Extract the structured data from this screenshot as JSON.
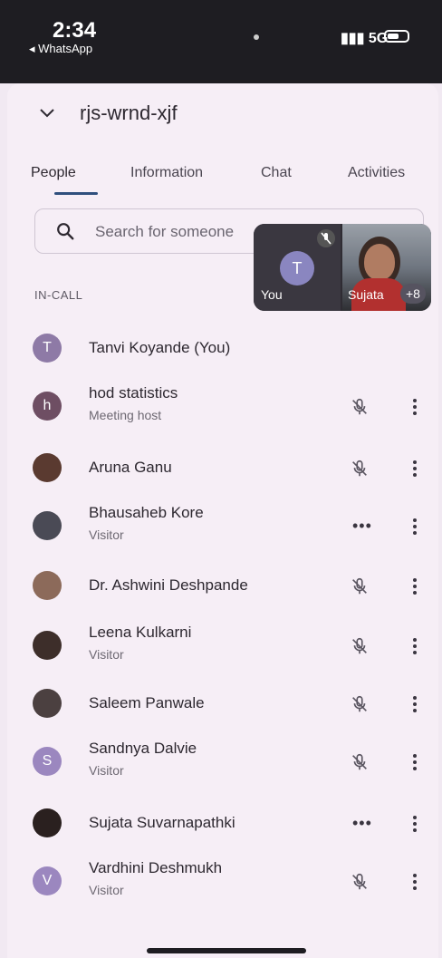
{
  "status_bar": {
    "time": "2:34",
    "back_app": "◂ WhatsApp",
    "network": "5G"
  },
  "header": {
    "title": "rjs-wrnd-xjf"
  },
  "tabs": [
    "People",
    "Information",
    "Chat",
    "Activities"
  ],
  "active_tab": "People",
  "search": {
    "placeholder": "Search for someone"
  },
  "pip": {
    "self_label": "You",
    "self_initial": "T",
    "other_label": "Sujata",
    "more_count": "+8"
  },
  "section_label": "IN-CALL",
  "participants": [
    {
      "name": "Tanvi Koyande (You)",
      "subtitle": "",
      "initial": "T",
      "avatar_color": "#8e7aa6",
      "status": "none"
    },
    {
      "name": "hod statistics",
      "subtitle": "Meeting host",
      "initial": "h",
      "avatar_color": "#6e4e63",
      "status": "muted"
    },
    {
      "name": "Aruna Ganu",
      "subtitle": "",
      "initial": "",
      "avatar_color": "#5a3a30",
      "status": "muted"
    },
    {
      "name": "Bhausaheb Kore",
      "subtitle": "Visitor",
      "initial": "",
      "avatar_color": "#4a4a55",
      "status": "more"
    },
    {
      "name": "Dr. Ashwini Deshpande",
      "subtitle": "",
      "initial": "",
      "avatar_color": "#8c6a5a",
      "status": "muted"
    },
    {
      "name": "Leena Kulkarni",
      "subtitle": "Visitor",
      "initial": "",
      "avatar_color": "#3d2e2a",
      "status": "muted"
    },
    {
      "name": "Saleem Panwale",
      "subtitle": "",
      "initial": "",
      "avatar_color": "#4b4040",
      "status": "muted"
    },
    {
      "name": "Sandnya Dalvie",
      "subtitle": "Visitor",
      "initial": "S",
      "avatar_color": "#9b87bf",
      "status": "muted"
    },
    {
      "name": "Sujata Suvarnapathki",
      "subtitle": "",
      "initial": "",
      "avatar_color": "#2a201f",
      "status": "more"
    },
    {
      "name": "Vardhini Deshmukh",
      "subtitle": "Visitor",
      "initial": "V",
      "avatar_color": "#9b87bf",
      "status": "muted"
    }
  ],
  "colors": {
    "accent": "#2f4f7d",
    "background": "#f6eef6"
  }
}
